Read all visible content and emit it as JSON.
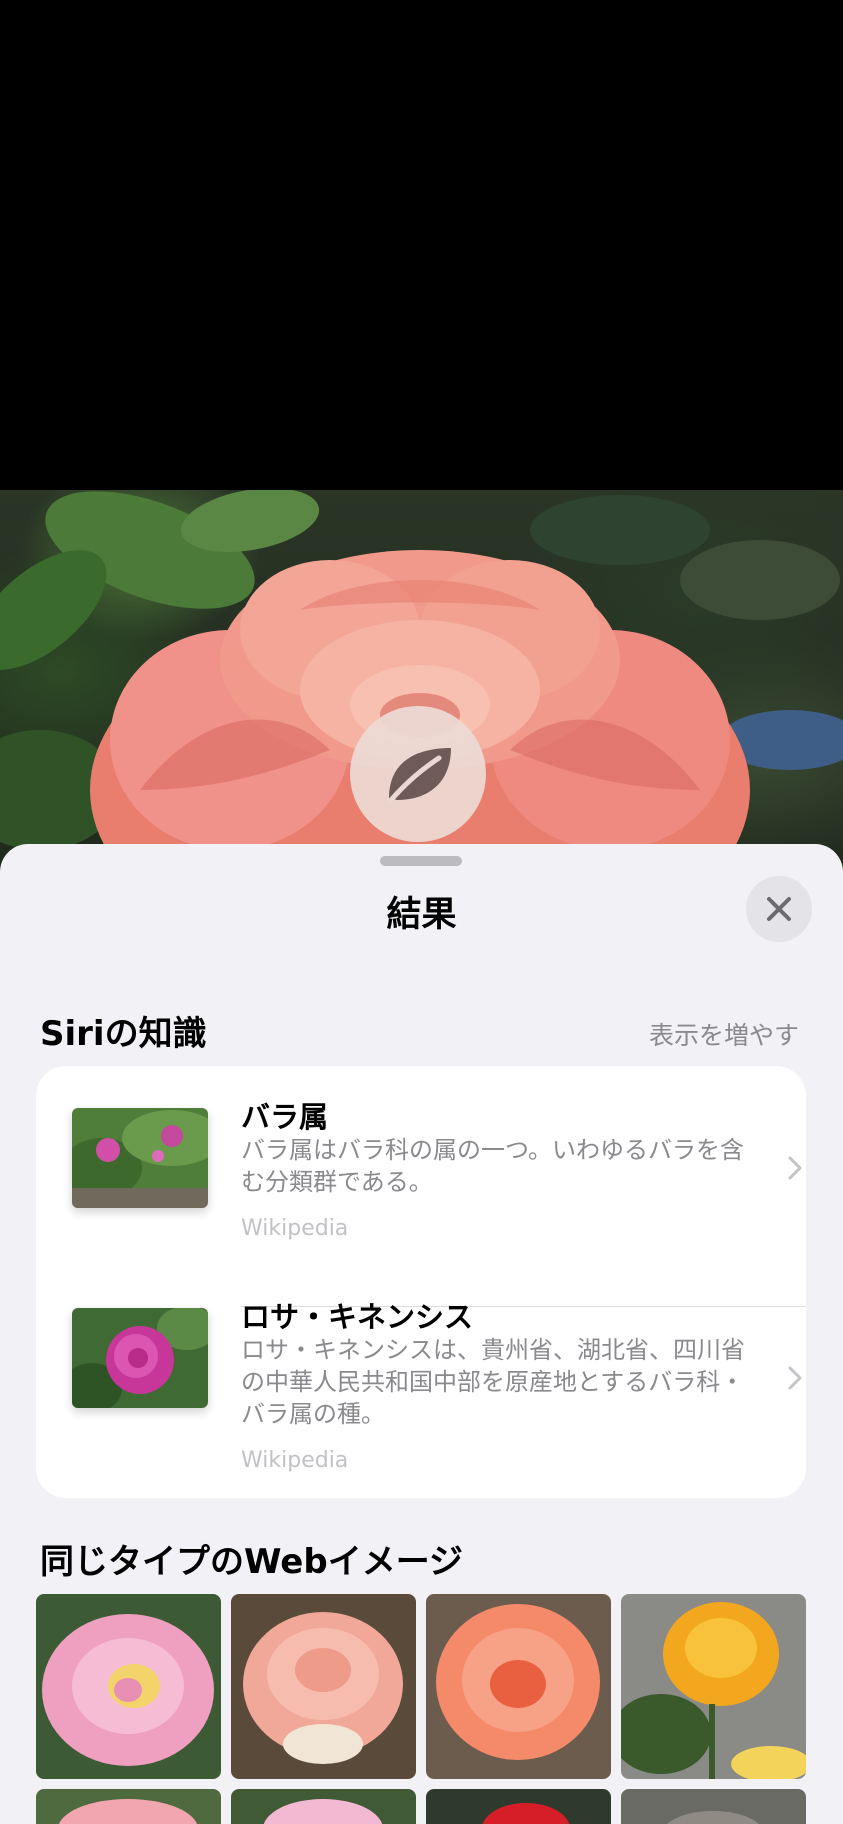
{
  "sheet": {
    "title": "結果",
    "close_icon": "xmark-icon"
  },
  "lookup_badge": {
    "icon": "leaf-icon"
  },
  "siri_knowledge": {
    "header": "Siriの知識",
    "show_more": "表示を増やす",
    "results": [
      {
        "title": "バラ属",
        "description": "バラ属はバラ科の属の一つ。いわゆるバラを含む分類群である。",
        "source": "Wikipedia"
      },
      {
        "title": "ロサ・キネンシス",
        "description": "ロサ・キネンシスは、貴州省、湖北省、四川省の中華人民共和国中部を原産地とするバラ科・バラ属の種。",
        "source": "Wikipedia"
      }
    ]
  },
  "web_images": {
    "header": "同じタイプのWebイメージ"
  },
  "colors": {
    "sheet_background": "#f2f1f6",
    "card_background": "#ffffff",
    "secondary_text": "#8a8a8e"
  }
}
